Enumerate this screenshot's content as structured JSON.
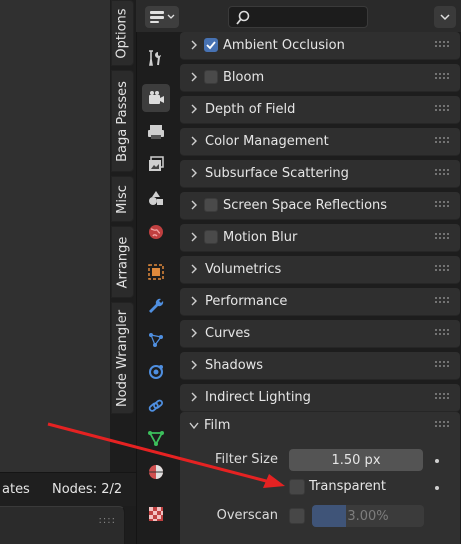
{
  "node_editor": {
    "status_left": "ates",
    "status_nodes": "Nodes: 2/2"
  },
  "vertical_tabs": [
    "Options",
    "Baga Passes",
    "Misc",
    "Arrange",
    "Node Wrangler"
  ],
  "properties_tabs": [
    {
      "icon": "tool-icon",
      "active": false
    },
    {
      "icon": "render-icon",
      "active": true
    },
    {
      "icon": "output-icon",
      "active": false
    },
    {
      "icon": "view-layer-icon",
      "active": false
    },
    {
      "icon": "scene-icon",
      "active": false
    },
    {
      "icon": "world-icon",
      "active": false
    },
    {
      "icon": "object-icon",
      "active": false
    },
    {
      "icon": "modifier-icon",
      "active": false
    },
    {
      "icon": "particles-icon",
      "active": false
    },
    {
      "icon": "physics-icon",
      "active": false
    },
    {
      "icon": "constraints-icon",
      "active": false
    },
    {
      "icon": "data-icon",
      "active": false
    },
    {
      "icon": "material-icon",
      "active": false
    },
    {
      "icon": "texture-icon",
      "active": false
    }
  ],
  "header": {
    "search_placeholder": ""
  },
  "panels": [
    {
      "title": "Ambient Occlusion",
      "has_checkbox": true,
      "checked": true
    },
    {
      "title": "Bloom",
      "has_checkbox": true,
      "checked": false
    },
    {
      "title": "Depth of Field",
      "has_checkbox": false
    },
    {
      "title": "Color Management",
      "has_checkbox": false
    },
    {
      "title": "Subsurface Scattering",
      "has_checkbox": false
    },
    {
      "title": "Screen Space Reflections",
      "has_checkbox": true,
      "checked": false
    },
    {
      "title": "Motion Blur",
      "has_checkbox": true,
      "checked": false
    },
    {
      "title": "Volumetrics",
      "has_checkbox": false
    },
    {
      "title": "Performance",
      "has_checkbox": false
    },
    {
      "title": "Curves",
      "has_checkbox": false
    },
    {
      "title": "Shadows",
      "has_checkbox": false
    },
    {
      "title": "Indirect Lighting",
      "has_checkbox": false
    }
  ],
  "film": {
    "title": "Film",
    "filter_size_label": "Filter Size",
    "filter_size_value": "1.50 px",
    "transparent_label": "Transparent",
    "transparent_checked": false,
    "overscan_label": "Overscan",
    "overscan_checked": false,
    "overscan_value": "3.00%",
    "overscan_fraction": 0.3
  },
  "annotation": {
    "arrow_color": "#e52222"
  },
  "colors": {
    "accent": "#4772b3"
  }
}
